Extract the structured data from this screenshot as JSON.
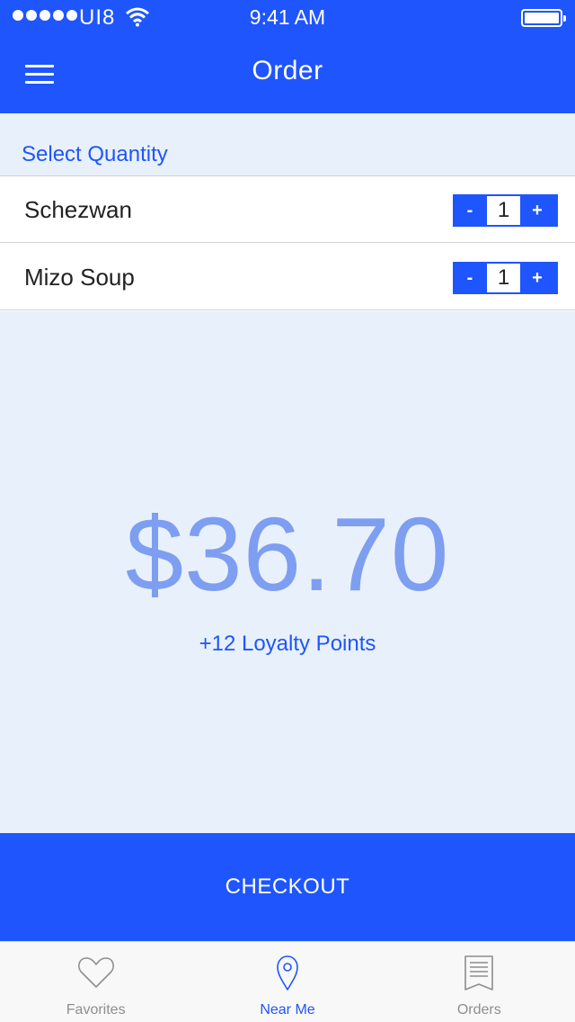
{
  "status_bar": {
    "carrier": "UI8",
    "time": "9:41 AM"
  },
  "nav": {
    "title": "Order"
  },
  "quantity_section": {
    "title": "Select Quantity",
    "items": [
      {
        "name": "Schezwan",
        "quantity": "1",
        "decrement_label": "-",
        "increment_label": "+"
      },
      {
        "name": "Mizo Soup",
        "quantity": "1",
        "decrement_label": "-",
        "increment_label": "+"
      }
    ]
  },
  "total": {
    "amount": "$36.70",
    "loyalty": "+12 Loyalty Points"
  },
  "checkout": {
    "label": "CHECKOUT"
  },
  "tab_bar": {
    "tabs": [
      {
        "label": "Favorites",
        "icon": "heart-icon",
        "active": false
      },
      {
        "label": "Near Me",
        "icon": "map-pin-icon",
        "active": true
      },
      {
        "label": "Orders",
        "icon": "receipt-icon",
        "active": false
      }
    ]
  },
  "colors": {
    "brand_blue": "#1f55fc",
    "total_text": "#7e9ef1",
    "panel_background": "#e8f1fb",
    "inactive_tab": "#8e8e8e"
  }
}
